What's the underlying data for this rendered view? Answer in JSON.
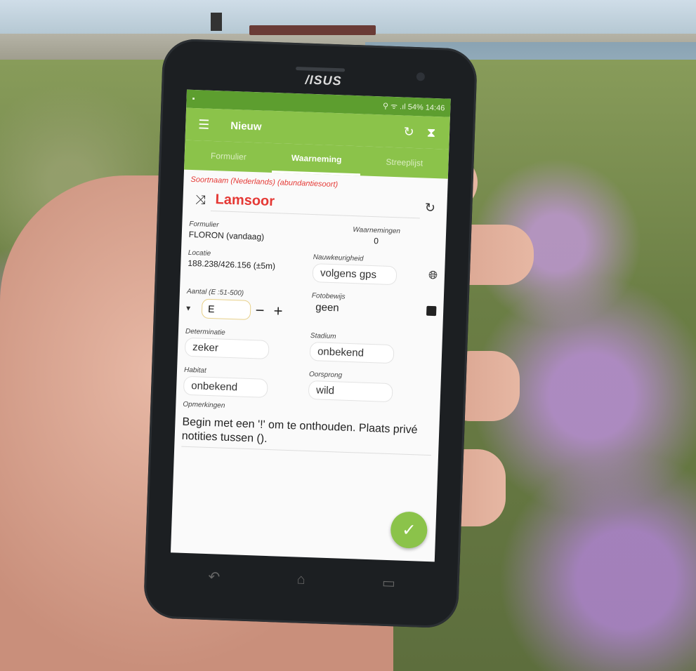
{
  "phone": {
    "brand": "/ISUS"
  },
  "statusbar": {
    "indicators": "⚲ ᯤ .ıl 54%",
    "time": "14:46"
  },
  "appbar": {
    "title": "Nieuw"
  },
  "tabs": [
    {
      "label": "Formulier",
      "active": false
    },
    {
      "label": "Waarneming",
      "active": true
    },
    {
      "label": "Streeplijst",
      "active": false
    }
  ],
  "form": {
    "species_label": "Soortnaam (Nederlands) (abundantiesoort)",
    "species_name": "Lamsoor",
    "formulier_label": "Formulier",
    "formulier_value": "FLORON (vandaag)",
    "waarnemingen_label": "Waarnemingen",
    "waarnemingen_value": "0",
    "locatie_label": "Locatie",
    "locatie_value": "188.238/426.156 (±5m)",
    "nauwkeurigheid_label": "Nauwkeurigheid",
    "nauwkeurigheid_value": "volgens gps",
    "aantal_label": "Aantal (E :51-500)",
    "aantal_value": "E",
    "fotobewijs_label": "Fotobewijs",
    "fotobewijs_value": "geen",
    "determinatie_label": "Determinatie",
    "determinatie_value": "zeker",
    "stadium_label": "Stadium",
    "stadium_value": "onbekend",
    "habitat_label": "Habitat",
    "habitat_value": "onbekend",
    "oorsprong_label": "Oorsprong",
    "oorsprong_value": "wild",
    "opmerkingen_label": "Opmerkingen",
    "opmerkingen_placeholder": "Begin met een '!' om te onthouden. Plaats privé notities tussen ()."
  },
  "colors": {
    "primary": "#8bc34a",
    "primary_dark": "#5d9e2f",
    "accent_red": "#e53935"
  },
  "icons": [
    "menu-icon",
    "refresh-icon",
    "hourglass-icon",
    "shuffle-icon",
    "globe-icon",
    "photo-icon",
    "check-icon",
    "back-icon",
    "home-icon",
    "recent-apps-icon"
  ]
}
